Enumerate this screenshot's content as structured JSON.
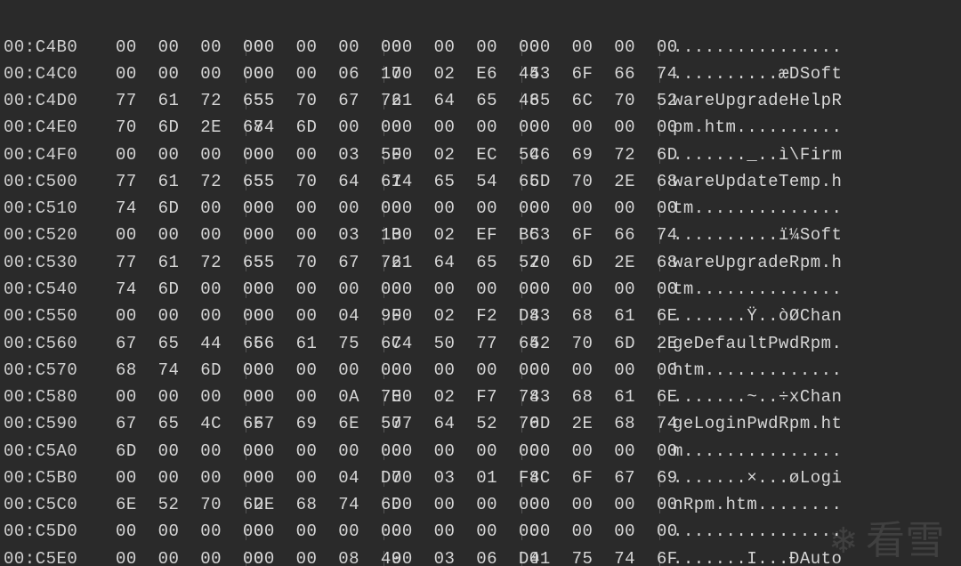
{
  "watermark": "看雪",
  "rows": [
    {
      "offset": "00:C4B0",
      "hex": [
        "00",
        "00",
        "00",
        "00",
        "00",
        "00",
        "00",
        "00",
        "00",
        "00",
        "00",
        "00",
        "00",
        "00",
        "00",
        "00"
      ],
      "ascii": "................"
    },
    {
      "offset": "00:C4C0",
      "hex": [
        "00",
        "00",
        "00",
        "00",
        "00",
        "00",
        "06",
        "17",
        "00",
        "02",
        "E6",
        "44",
        "53",
        "6F",
        "66",
        "74"
      ],
      "ascii": "..........æDSoft"
    },
    {
      "offset": "00:C4D0",
      "hex": [
        "77",
        "61",
        "72",
        "65",
        "55",
        "70",
        "67",
        "72",
        "61",
        "64",
        "65",
        "48",
        "65",
        "6C",
        "70",
        "52"
      ],
      "ascii": "wareUpgradeHelpR"
    },
    {
      "offset": "00:C4E0",
      "hex": [
        "70",
        "6D",
        "2E",
        "68",
        "74",
        "6D",
        "00",
        "00",
        "00",
        "00",
        "00",
        "00",
        "00",
        "00",
        "00",
        "00"
      ],
      "ascii": "pm.htm.........."
    },
    {
      "offset": "00:C4F0",
      "hex": [
        "00",
        "00",
        "00",
        "00",
        "00",
        "00",
        "03",
        "5F",
        "00",
        "02",
        "EC",
        "5C",
        "46",
        "69",
        "72",
        "6D"
      ],
      "ascii": "......._..ì\\Firm"
    },
    {
      "offset": "00:C500",
      "hex": [
        "77",
        "61",
        "72",
        "65",
        "55",
        "70",
        "64",
        "61",
        "74",
        "65",
        "54",
        "65",
        "6D",
        "70",
        "2E",
        "68"
      ],
      "ascii": "wareUpdateTemp.h"
    },
    {
      "offset": "00:C510",
      "hex": [
        "74",
        "6D",
        "00",
        "00",
        "00",
        "00",
        "00",
        "00",
        "00",
        "00",
        "00",
        "00",
        "00",
        "00",
        "00",
        "00"
      ],
      "ascii": "tm.............."
    },
    {
      "offset": "00:C520",
      "hex": [
        "00",
        "00",
        "00",
        "00",
        "00",
        "00",
        "03",
        "1B",
        "00",
        "02",
        "EF",
        "BC",
        "53",
        "6F",
        "66",
        "74"
      ],
      "ascii": "..........ï¼Soft"
    },
    {
      "offset": "00:C530",
      "hex": [
        "77",
        "61",
        "72",
        "65",
        "55",
        "70",
        "67",
        "72",
        "61",
        "64",
        "65",
        "52",
        "70",
        "6D",
        "2E",
        "68"
      ],
      "ascii": "wareUpgradeRpm.h"
    },
    {
      "offset": "00:C540",
      "hex": [
        "74",
        "6D",
        "00",
        "00",
        "00",
        "00",
        "00",
        "00",
        "00",
        "00",
        "00",
        "00",
        "00",
        "00",
        "00",
        "00"
      ],
      "ascii": "tm.............."
    },
    {
      "offset": "00:C550",
      "hex": [
        "00",
        "00",
        "00",
        "00",
        "00",
        "00",
        "04",
        "9F",
        "00",
        "02",
        "F2",
        "D8",
        "43",
        "68",
        "61",
        "6E"
      ],
      "ascii": ".......Ÿ..òØChan"
    },
    {
      "offset": "00:C560",
      "hex": [
        "67",
        "65",
        "44",
        "65",
        "66",
        "61",
        "75",
        "6C",
        "74",
        "50",
        "77",
        "64",
        "52",
        "70",
        "6D",
        "2E"
      ],
      "ascii": "geDefaultPwdRpm."
    },
    {
      "offset": "00:C570",
      "hex": [
        "68",
        "74",
        "6D",
        "00",
        "00",
        "00",
        "00",
        "00",
        "00",
        "00",
        "00",
        "00",
        "00",
        "00",
        "00",
        "00"
      ],
      "ascii": "htm............."
    },
    {
      "offset": "00:C580",
      "hex": [
        "00",
        "00",
        "00",
        "00",
        "00",
        "00",
        "0A",
        "7E",
        "00",
        "02",
        "F7",
        "78",
        "43",
        "68",
        "61",
        "6E"
      ],
      "ascii": ".......~..÷xChan"
    },
    {
      "offset": "00:C590",
      "hex": [
        "67",
        "65",
        "4C",
        "6F",
        "67",
        "69",
        "6E",
        "50",
        "77",
        "64",
        "52",
        "70",
        "6D",
        "2E",
        "68",
        "74"
      ],
      "ascii": "geLoginPwdRpm.ht"
    },
    {
      "offset": "00:C5A0",
      "hex": [
        "6D",
        "00",
        "00",
        "00",
        "00",
        "00",
        "00",
        "00",
        "00",
        "00",
        "00",
        "00",
        "00",
        "00",
        "00",
        "00"
      ],
      "ascii": "m..............."
    },
    {
      "offset": "00:C5B0",
      "hex": [
        "00",
        "00",
        "00",
        "00",
        "00",
        "00",
        "04",
        "D7",
        "00",
        "03",
        "01",
        "F8",
        "4C",
        "6F",
        "67",
        "69"
      ],
      "ascii": ".......×...øLogi"
    },
    {
      "offset": "00:C5C0",
      "hex": [
        "6E",
        "52",
        "70",
        "6D",
        "2E",
        "68",
        "74",
        "6D",
        "00",
        "00",
        "00",
        "00",
        "00",
        "00",
        "00",
        "00"
      ],
      "ascii": "nRpm.htm........"
    },
    {
      "offset": "00:C5D0",
      "hex": [
        "00",
        "00",
        "00",
        "00",
        "00",
        "00",
        "00",
        "00",
        "00",
        "00",
        "00",
        "00",
        "00",
        "00",
        "00",
        "00"
      ],
      "ascii": "................"
    },
    {
      "offset": "00:C5E0",
      "hex": [
        "00",
        "00",
        "00",
        "00",
        "00",
        "00",
        "08",
        "49",
        "00",
        "03",
        "06",
        "D0",
        "41",
        "75",
        "74",
        "6F"
      ],
      "ascii": ".......I...ÐAuto"
    }
  ]
}
